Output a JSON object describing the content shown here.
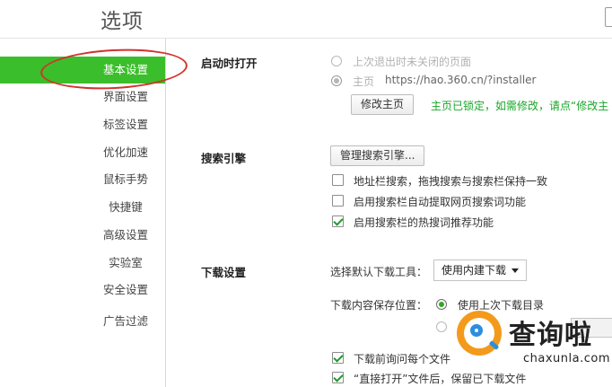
{
  "window": {
    "title": "选项"
  },
  "sidebar": {
    "items": [
      {
        "label": "基本设置",
        "active": true
      },
      {
        "label": "界面设置"
      },
      {
        "label": "标签设置"
      },
      {
        "label": "优化加速"
      },
      {
        "label": "鼠标手势"
      },
      {
        "label": "快捷键"
      },
      {
        "label": "高级设置"
      },
      {
        "label": "实验室"
      },
      {
        "label": "安全设置"
      },
      {
        "label": "广告过滤"
      }
    ]
  },
  "startup": {
    "title": "启动时打开",
    "option_last_session": "上次退出时未关闭的页面",
    "option_homepage_label": "主页",
    "homepage_url": "https://hao.360.cn/?installer",
    "edit_homepage_button": "修改主页",
    "homepage_locked_notice": "主页已锁定，如需修改，请点“修改主"
  },
  "search": {
    "title": "搜索引擎",
    "manage_button": "管理搜索引擎...",
    "options": [
      {
        "label": "地址栏搜索，拖拽搜索与搜索栏保持一致",
        "checked": false
      },
      {
        "label": "启用搜索栏自动提取网页搜索词功能",
        "checked": false
      },
      {
        "label": "启用搜索栏的热搜词推荐功能",
        "checked": true
      }
    ]
  },
  "download": {
    "title": "下载设置",
    "default_tool_label": "选择默认下载工具：",
    "default_tool_value": "使用内建下载",
    "save_location_label": "下载内容保存位置：",
    "save_location_option": "使用上次下载目录",
    "ask_each_file": "下载前询问每个文件",
    "keep_after_open": "“直接打开”文件后，保留已下载文件"
  },
  "watermark": {
    "brand_cn": "查询啦",
    "brand_en": "chaxunla.com"
  },
  "colors": {
    "accent": "#3bbe2b",
    "link_green": "#1aa52a",
    "annotation_red": "#d0342c",
    "watermark_orange": "#f39a1c",
    "watermark_blue": "#2d8de0"
  },
  "icons": {
    "radio": "radio-icon",
    "checkbox": "checkbox-icon",
    "dropdown": "chevron-down-icon",
    "watermark": "magnifier-logo-icon"
  }
}
